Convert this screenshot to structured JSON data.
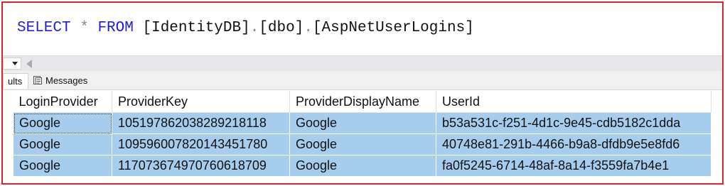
{
  "editor": {
    "query_tokens": [
      {
        "type": "kw",
        "text": "SELECT"
      },
      {
        "type": "sp",
        "text": " "
      },
      {
        "type": "op",
        "text": "*"
      },
      {
        "type": "sp",
        "text": " "
      },
      {
        "type": "kw",
        "text": "FROM"
      },
      {
        "type": "sp",
        "text": " "
      },
      {
        "type": "id",
        "text": "[IdentityDB]"
      },
      {
        "type": "dot",
        "text": "."
      },
      {
        "type": "id",
        "text": "[dbo]"
      },
      {
        "type": "dot",
        "text": "."
      },
      {
        "type": "id",
        "text": "[AspNetUserLogins]"
      }
    ]
  },
  "tabs": {
    "results_label": "ults",
    "messages_label": "Messages"
  },
  "grid": {
    "columns": [
      "LoginProvider",
      "ProviderKey",
      "ProviderDisplayName",
      "UserId"
    ],
    "rows": [
      [
        "Google",
        "105197862038289218118",
        "Google",
        "b53a531c-f251-4d1c-9e45-cdb5182c1dda"
      ],
      [
        "Google",
        "109596007820143451780",
        "Google",
        "40748e81-291b-4466-b9a8-dfdb9e5e8fd6"
      ],
      [
        "Google",
        "117073674970760618709",
        "Google",
        "fa0f5245-6714-48af-8a14-f3559fa7b4e1"
      ]
    ]
  },
  "colors": {
    "keyword": "#1f1fd6",
    "selection": "#a6cdee",
    "border": "#d9262b"
  }
}
